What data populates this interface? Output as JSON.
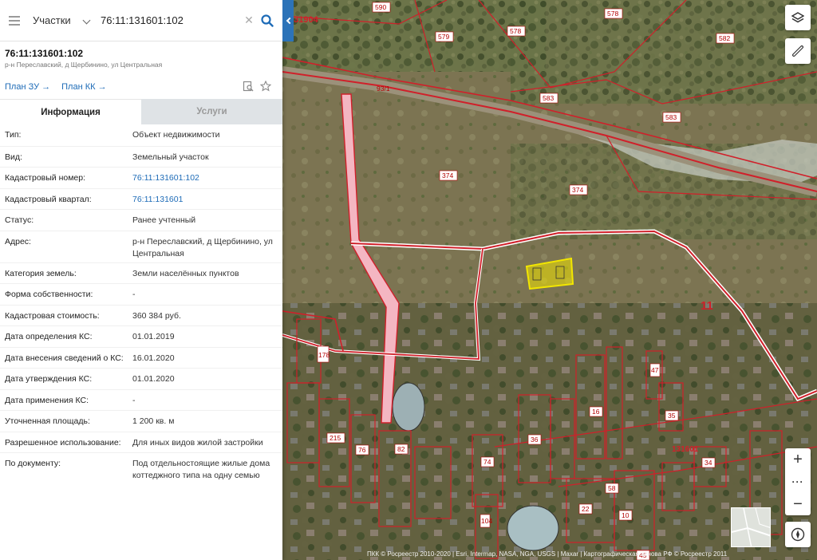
{
  "search": {
    "type_label": "Участки",
    "value": "76:11:131601:102"
  },
  "object": {
    "title": "76:11:131601:102",
    "subtitle": "р-н Переславский, д Щербинино, ул Центральная",
    "plan_zu": "План ЗУ →",
    "plan_kk": "План КК →"
  },
  "tabs": {
    "info": "Информация",
    "services": "Услуги"
  },
  "info": [
    {
      "label": "Тип:",
      "value": "Объект недвижимости"
    },
    {
      "label": "Вид:",
      "value": "Земельный участок"
    },
    {
      "label": "Кадастровый номер:",
      "value": "76:11:131601:102"
    },
    {
      "label": "Кадастровый квартал:",
      "value": "76:11:131601"
    },
    {
      "label": "Статус:",
      "value": "Ранее учтенный"
    },
    {
      "label": "Адрес:",
      "value": "р-н Переславский, д Щербинино, ул Центральная"
    },
    {
      "label": "Категория земель:",
      "value": "Земли населённых пунктов"
    },
    {
      "label": "Форма собственности:",
      "value": "-"
    },
    {
      "label": "Кадастровая стоимость:",
      "value": "360 384 руб."
    },
    {
      "label": "Дата определения КС:",
      "value": "01.01.2019"
    },
    {
      "label": "Дата внесения сведений о КС:",
      "value": "16.01.2020"
    },
    {
      "label": "Дата утверждения КС:",
      "value": "01.01.2020"
    },
    {
      "label": "Дата применения КС:",
      "value": "-"
    },
    {
      "label": "Уточненная площадь:",
      "value": "1 200 кв. м"
    },
    {
      "label": "Разрешенное использование:",
      "value": "Для иных видов жилой застройки"
    },
    {
      "label": "По документу:",
      "value": "Под отдельностоящие жилые дома коттеджного типа на одну семью"
    }
  ],
  "map": {
    "labels": {
      "q131904": "131904",
      "p590": "590",
      "p578": "578",
      "p579": "579",
      "p578b": "578",
      "p582": "582",
      "p93": "93/1",
      "p583": "583",
      "p583b": "583",
      "p374": "374",
      "p374b": "374",
      "p11": "11",
      "q131601": "131601",
      "p178": "178",
      "p215": "215",
      "p76": "76",
      "p82": "82",
      "p74": "74",
      "p36": "36",
      "p16": "16",
      "p35": "35",
      "p34": "34",
      "p58": "58",
      "p22": "22",
      "p10": "10",
      "p47": "47",
      "p104": "104",
      "p45": "45"
    },
    "attribution": "ПКК © Росреестр 2010-2020 | Esri, Intermap, NASA, NGA, USGS | Maxar | Картографическая основа РФ © Росреестр 2011"
  },
  "colors": {
    "accent": "#1d6bb7",
    "boundary": "#d0202a",
    "selected": "#f2e600",
    "road_strip": "#f4b6c2"
  },
  "icons": {
    "menu": "menu-icon",
    "search": "search-icon",
    "clear": "close-icon",
    "layers": "layers-icon",
    "ruler": "ruler-icon",
    "compass": "compass-icon"
  }
}
